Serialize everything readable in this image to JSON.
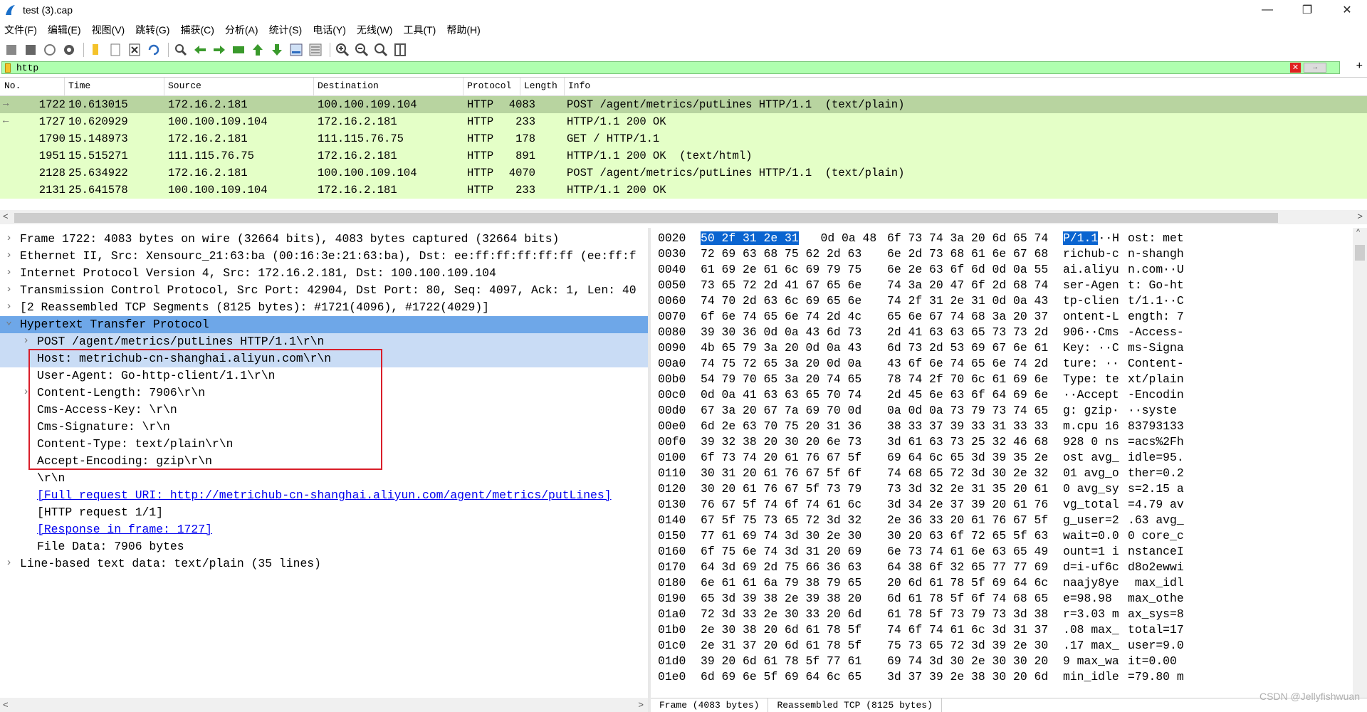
{
  "window": {
    "title": "test (3).cap"
  },
  "menu": [
    "文件(F)",
    "编辑(E)",
    "视图(V)",
    "跳转(G)",
    "捕获(C)",
    "分析(A)",
    "统计(S)",
    "电话(Y)",
    "无线(W)",
    "工具(T)",
    "帮助(H)"
  ],
  "toolbar": {
    "buttons": [
      "start-capture-icon",
      "stop-capture-icon",
      "restart-capture-icon",
      "capture-options-icon",
      "open-file-icon",
      "save-file-icon",
      "close-file-icon",
      "reload-icon",
      "find-packet-icon",
      "go-back-icon",
      "go-forward-icon",
      "go-to-packet-icon",
      "go-first-icon",
      "go-last-icon",
      "autoscroll-icon",
      "colorize-icon",
      "zoom-in-icon",
      "zoom-out-icon",
      "zoom-normal-icon",
      "resize-columns-icon"
    ]
  },
  "filter": {
    "value": "http",
    "apply_label": "→"
  },
  "packet_list": {
    "columns": [
      "No.",
      "Time",
      "Source",
      "Destination",
      "Protocol",
      "Length",
      "Info"
    ],
    "rows": [
      {
        "no": "1722",
        "time": "10.613015",
        "src": "172.16.2.181",
        "dst": "100.100.109.104",
        "proto": "HTTP",
        "len": "4083",
        "info": "POST /agent/metrics/putLines HTTP/1.1  (text/plain)",
        "selected": true,
        "arrow": "→"
      },
      {
        "no": "1727",
        "time": "10.620929",
        "src": "100.100.109.104",
        "dst": "172.16.2.181",
        "proto": "HTTP",
        "len": "233",
        "info": "HTTP/1.1 200 OK",
        "selected": false,
        "arrow": "←"
      },
      {
        "no": "1790",
        "time": "15.148973",
        "src": "172.16.2.181",
        "dst": "111.115.76.75",
        "proto": "HTTP",
        "len": "178",
        "info": "GET / HTTP/1.1",
        "selected": false,
        "arrow": ""
      },
      {
        "no": "1951",
        "time": "15.515271",
        "src": "111.115.76.75",
        "dst": "172.16.2.181",
        "proto": "HTTP",
        "len": "891",
        "info": "HTTP/1.1 200 OK  (text/html)",
        "selected": false,
        "arrow": ""
      },
      {
        "no": "2128",
        "time": "25.634922",
        "src": "172.16.2.181",
        "dst": "100.100.109.104",
        "proto": "HTTP",
        "len": "4070",
        "info": "POST /agent/metrics/putLines HTTP/1.1  (text/plain)",
        "selected": false,
        "arrow": ""
      },
      {
        "no": "2131",
        "time": "25.641578",
        "src": "100.100.109.104",
        "dst": "172.16.2.181",
        "proto": "HTTP",
        "len": "233",
        "info": "HTTP/1.1 200 OK",
        "selected": false,
        "arrow": ""
      }
    ]
  },
  "details": [
    {
      "text": "Frame 1722: 4083 bytes on wire (32664 bits), 4083 bytes captured (32664 bits)",
      "expander": ">",
      "indent": 0,
      "style": ""
    },
    {
      "text": "Ethernet II, Src: Xensourc_21:63:ba (00:16:3e:21:63:ba), Dst: ee:ff:ff:ff:ff:ff (ee:ff:f",
      "expander": ">",
      "indent": 0,
      "style": ""
    },
    {
      "text": "Internet Protocol Version 4, Src: 172.16.2.181, Dst: 100.100.109.104",
      "expander": ">",
      "indent": 0,
      "style": ""
    },
    {
      "text": "Transmission Control Protocol, Src Port: 42904, Dst Port: 80, Seq: 4097, Ack: 1, Len: 40",
      "expander": ">",
      "indent": 0,
      "style": ""
    },
    {
      "text": "[2 Reassembled TCP Segments (8125 bytes): #1721(4096), #1722(4029)]",
      "expander": ">",
      "indent": 0,
      "style": ""
    },
    {
      "text": "Hypertext Transfer Protocol",
      "expander": "v",
      "indent": 0,
      "style": "http-head"
    },
    {
      "text": "POST /agent/metrics/putLines HTTP/1.1\\r\\n",
      "expander": ">",
      "indent": 1,
      "style": "http-sub"
    },
    {
      "text": "Host: metrichub-cn-shanghai.aliyun.com\\r\\n",
      "expander": "",
      "indent": 1,
      "style": "http-sub"
    },
    {
      "text": "User-Agent: Go-http-client/1.1\\r\\n",
      "expander": "",
      "indent": 1,
      "style": ""
    },
    {
      "text": "Content-Length: 7906\\r\\n",
      "expander": ">",
      "indent": 1,
      "style": ""
    },
    {
      "text": "Cms-Access-Key: \\r\\n",
      "expander": "",
      "indent": 1,
      "style": ""
    },
    {
      "text": "Cms-Signature: \\r\\n",
      "expander": "",
      "indent": 1,
      "style": ""
    },
    {
      "text": "Content-Type: text/plain\\r\\n",
      "expander": "",
      "indent": 1,
      "style": ""
    },
    {
      "text": "Accept-Encoding: gzip\\r\\n",
      "expander": "",
      "indent": 1,
      "style": ""
    },
    {
      "text": "\\r\\n",
      "expander": "",
      "indent": 1,
      "style": ""
    },
    {
      "text": "[Full request URI: http://metrichub-cn-shanghai.aliyun.com/agent/metrics/putLines]",
      "expander": "",
      "indent": 1,
      "style": "link"
    },
    {
      "text": "[HTTP request 1/1]",
      "expander": "",
      "indent": 1,
      "style": ""
    },
    {
      "text": "[Response in frame: 1727]",
      "expander": "",
      "indent": 1,
      "style": "link"
    },
    {
      "text": "File Data: 7906 bytes",
      "expander": "",
      "indent": 1,
      "style": ""
    },
    {
      "text": "Line-based text data: text/plain (35 lines)",
      "expander": ">",
      "indent": 0,
      "style": ""
    }
  ],
  "bytes": [
    {
      "off": "0020",
      "hex1": "50 2f 31 2e 31",
      "hex1b": "0d 0a 48",
      "hex2": "6f 73 74 3a 20 6d 65 74",
      "asc1": "P/1.1",
      "asc1b": "··H",
      "asc2": "ost: met"
    },
    {
      "off": "0030",
      "hex1": "72 69 63 68 75 62 2d 63",
      "hex2": "6e 2d 73 68 61 6e 67 68",
      "asc1": "richub-c",
      "asc2": "n-shangh"
    },
    {
      "off": "0040",
      "hex1": "61 69 2e 61 6c 69 79 75",
      "hex2": "6e 2e 63 6f 6d 0d 0a 55",
      "asc1": "ai.aliyu",
      "asc2": "n.com··U"
    },
    {
      "off": "0050",
      "hex1": "73 65 72 2d 41 67 65 6e",
      "hex2": "74 3a 20 47 6f 2d 68 74",
      "asc1": "ser-Agen",
      "asc2": "t: Go-ht"
    },
    {
      "off": "0060",
      "hex1": "74 70 2d 63 6c 69 65 6e",
      "hex2": "74 2f 31 2e 31 0d 0a 43",
      "asc1": "tp-clien",
      "asc2": "t/1.1··C"
    },
    {
      "off": "0070",
      "hex1": "6f 6e 74 65 6e 74 2d 4c",
      "hex2": "65 6e 67 74 68 3a 20 37",
      "asc1": "ontent-L",
      "asc2": "ength: 7"
    },
    {
      "off": "0080",
      "hex1": "39 30 36 0d 0a 43 6d 73",
      "hex2": "2d 41 63 63 65 73 73 2d",
      "asc1": "906··Cms",
      "asc2": "-Access-"
    },
    {
      "off": "0090",
      "hex1": "4b 65 79 3a 20 0d 0a 43",
      "hex2": "6d 73 2d 53 69 67 6e 61",
      "asc1": "Key: ··C",
      "asc2": "ms-Signa"
    },
    {
      "off": "00a0",
      "hex1": "74 75 72 65 3a 20 0d 0a",
      "hex2": "43 6f 6e 74 65 6e 74 2d",
      "asc1": "ture: ··",
      "asc2": "Content-"
    },
    {
      "off": "00b0",
      "hex1": "54 79 70 65 3a 20 74 65",
      "hex2": "78 74 2f 70 6c 61 69 6e",
      "asc1": "Type: te",
      "asc2": "xt/plain"
    },
    {
      "off": "00c0",
      "hex1": "0d 0a 41 63 63 65 70 74",
      "hex2": "2d 45 6e 63 6f 64 69 6e",
      "asc1": "··Accept",
      "asc2": "-Encodin"
    },
    {
      "off": "00d0",
      "hex1": "67 3a 20 67 7a 69 70 0d",
      "hex2": "0a 0d 0a 73 79 73 74 65",
      "asc1": "g: gzip·",
      "asc2": "··syste"
    },
    {
      "off": "00e0",
      "hex1": "6d 2e 63 70 75 20 31 36",
      "hex2": "38 33 37 39 33 31 33 33",
      "asc1": "m.cpu 16",
      "asc2": "83793133"
    },
    {
      "off": "00f0",
      "hex1": "39 32 38 20 30 20 6e 73",
      "hex2": "3d 61 63 73 25 32 46 68",
      "asc1": "928 0 ns",
      "asc2": "=acs%2Fh"
    },
    {
      "off": "0100",
      "hex1": "6f 73 74 20 61 76 67 5f",
      "hex2": "69 64 6c 65 3d 39 35 2e",
      "asc1": "ost avg_",
      "asc2": "idle=95."
    },
    {
      "off": "0110",
      "hex1": "30 31 20 61 76 67 5f 6f",
      "hex2": "74 68 65 72 3d 30 2e 32",
      "asc1": "01 avg_o",
      "asc2": "ther=0.2"
    },
    {
      "off": "0120",
      "hex1": "30 20 61 76 67 5f 73 79",
      "hex2": "73 3d 32 2e 31 35 20 61",
      "asc1": "0 avg_sy",
      "asc2": "s=2.15 a"
    },
    {
      "off": "0130",
      "hex1": "76 67 5f 74 6f 74 61 6c",
      "hex2": "3d 34 2e 37 39 20 61 76",
      "asc1": "vg_total",
      "asc2": "=4.79 av"
    },
    {
      "off": "0140",
      "hex1": "67 5f 75 73 65 72 3d 32",
      "hex2": "2e 36 33 20 61 76 67 5f",
      "asc1": "g_user=2",
      "asc2": ".63 avg_"
    },
    {
      "off": "0150",
      "hex1": "77 61 69 74 3d 30 2e 30",
      "hex2": "30 20 63 6f 72 65 5f 63",
      "asc1": "wait=0.0",
      "asc2": "0 core_c"
    },
    {
      "off": "0160",
      "hex1": "6f 75 6e 74 3d 31 20 69",
      "hex2": "6e 73 74 61 6e 63 65 49",
      "asc1": "ount=1 i",
      "asc2": "nstanceI"
    },
    {
      "off": "0170",
      "hex1": "64 3d 69 2d 75 66 36 63",
      "hex2": "64 38 6f 32 65 77 77 69",
      "asc1": "d=i-uf6c",
      "asc2": "d8o2ewwi"
    },
    {
      "off": "0180",
      "hex1": "6e 61 61 6a 79 38 79 65",
      "hex2": "20 6d 61 78 5f 69 64 6c",
      "asc1": "naajy8ye",
      "asc2": " max_idl"
    },
    {
      "off": "0190",
      "hex1": "65 3d 39 38 2e 39 38 20",
      "hex2": "6d 61 78 5f 6f 74 68 65",
      "asc1": "e=98.98 ",
      "asc2": "max_othe"
    },
    {
      "off": "01a0",
      "hex1": "72 3d 33 2e 30 33 20 6d",
      "hex2": "61 78 5f 73 79 73 3d 38",
      "asc1": "r=3.03 m",
      "asc2": "ax_sys=8"
    },
    {
      "off": "01b0",
      "hex1": "2e 30 38 20 6d 61 78 5f",
      "hex2": "74 6f 74 61 6c 3d 31 37",
      "asc1": ".08 max_",
      "asc2": "total=17"
    },
    {
      "off": "01c0",
      "hex1": "2e 31 37 20 6d 61 78 5f",
      "hex2": "75 73 65 72 3d 39 2e 30",
      "asc1": ".17 max_",
      "asc2": "user=9.0"
    },
    {
      "off": "01d0",
      "hex1": "39 20 6d 61 78 5f 77 61",
      "hex2": "69 74 3d 30 2e 30 30 20",
      "asc1": "9 max_wa",
      "asc2": "it=0.00 "
    },
    {
      "off": "01e0",
      "hex1": "6d 69 6e 5f 69 64 6c 65",
      "hex2": "3d 37 39 2e 38 30 20 6d",
      "asc1": "min_idle",
      "asc2": "=79.80 m"
    }
  ],
  "byte_tabs": [
    "Frame (4083 bytes)",
    "Reassembled TCP (8125 bytes)"
  ],
  "watermark": "CSDN @Jellyfishwuan",
  "colors": {
    "row_bg": "#e4ffc7",
    "row_selected": "#b8d4a0",
    "http_highlight": "#6ea7e8",
    "byte_select": "#0a64d0",
    "highlight_box": "#d91e2a"
  }
}
